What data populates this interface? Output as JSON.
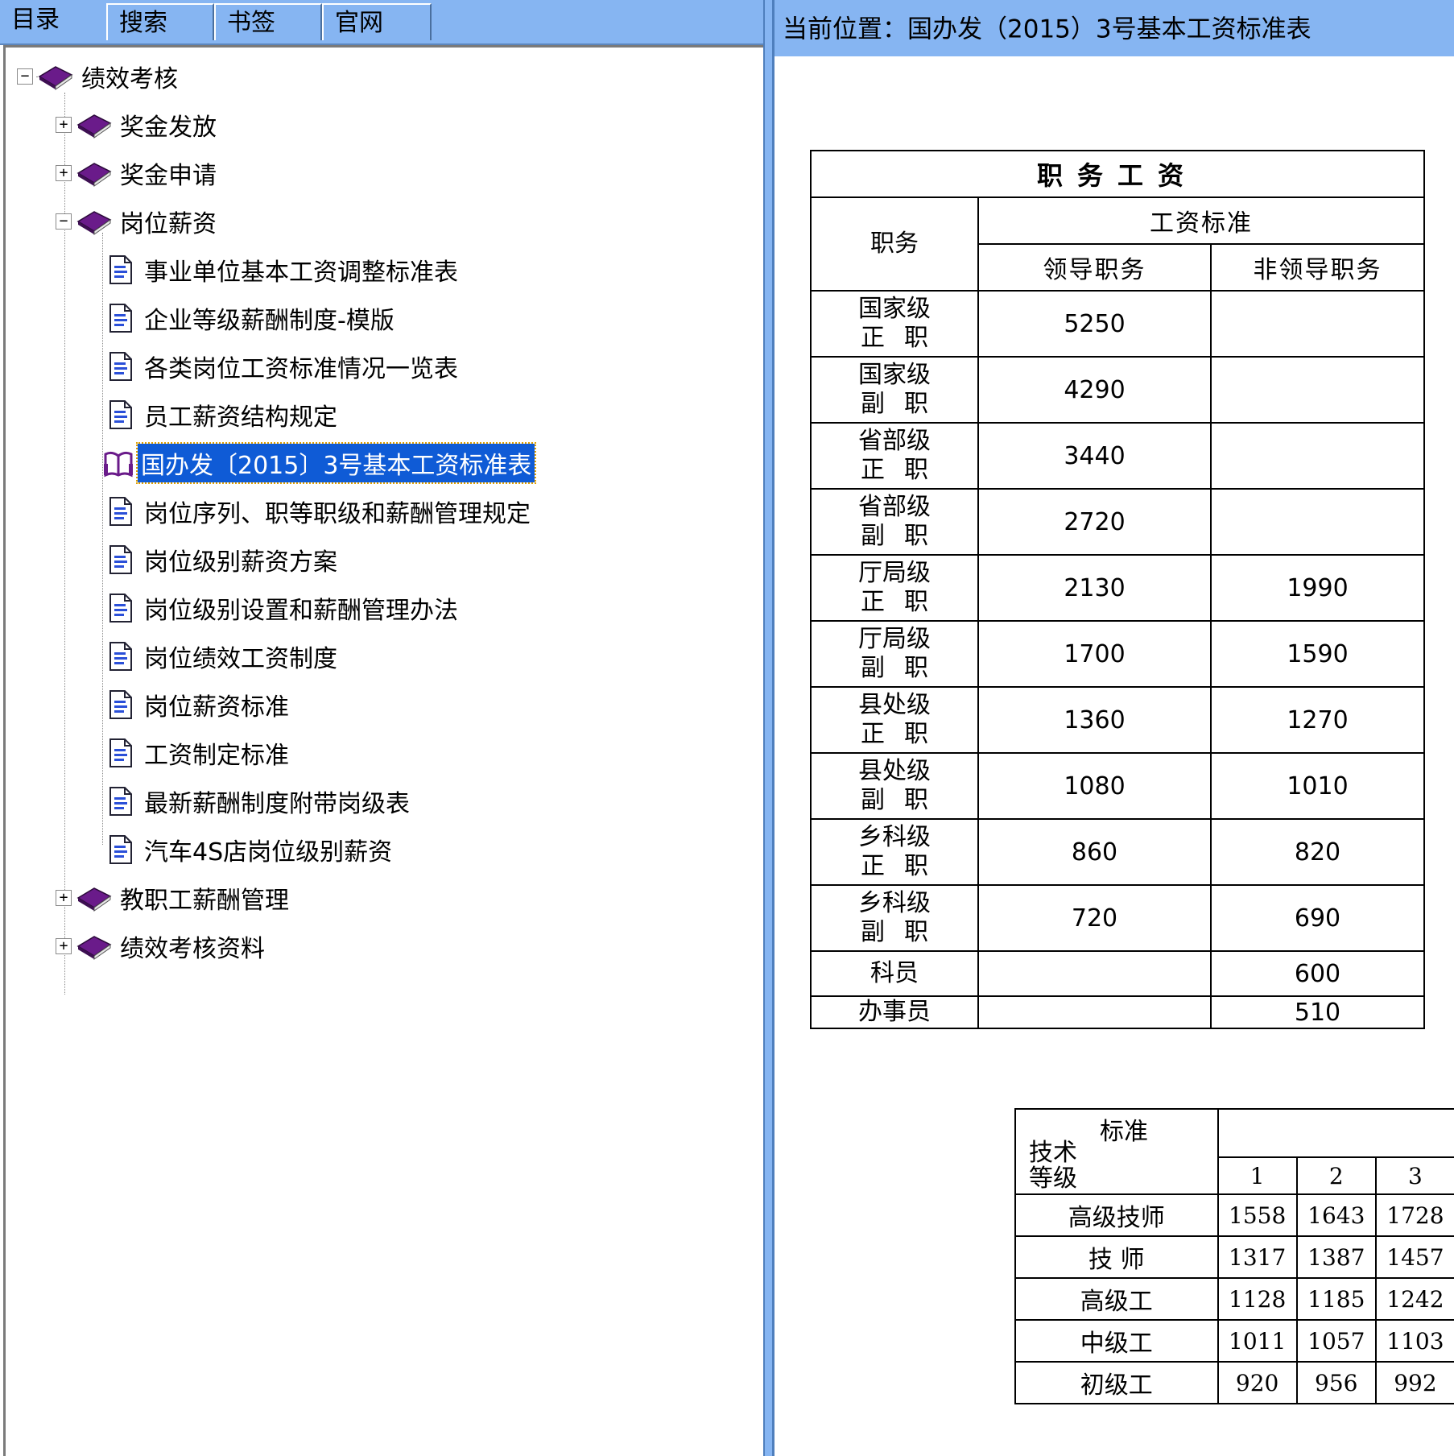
{
  "tabs": [
    {
      "label": "目录",
      "active": true
    },
    {
      "label": "搜索",
      "active": false
    },
    {
      "label": "书签",
      "active": false
    },
    {
      "label": "官网",
      "active": false
    }
  ],
  "tree": {
    "root": {
      "label": "绩效考核",
      "expander": "−"
    },
    "level1": [
      {
        "label": "奖金发放",
        "expander": "+"
      },
      {
        "label": "奖金申请",
        "expander": "+"
      },
      {
        "label": "岗位薪资",
        "expander": "−"
      },
      {
        "label": "教职工薪酬管理",
        "expander": "+"
      },
      {
        "label": "绩效考核资料",
        "expander": "+"
      }
    ],
    "docs": [
      {
        "label": "事业单位基本工资调整标准表"
      },
      {
        "label": "企业等级薪酬制度-模版"
      },
      {
        "label": "各类岗位工资标准情况一览表"
      },
      {
        "label": "员工薪资结构规定"
      },
      {
        "label": "国办发〔2015〕3号基本工资标准表",
        "selected": true
      },
      {
        "label": "岗位序列、职等职级和薪酬管理规定"
      },
      {
        "label": "岗位级别薪资方案"
      },
      {
        "label": "岗位级别设置和薪酬管理办法"
      },
      {
        "label": "岗位绩效工资制度"
      },
      {
        "label": "岗位薪资标准"
      },
      {
        "label": "工资制定标准"
      },
      {
        "label": "最新薪酬制度附带岗级表"
      },
      {
        "label": "汽车4S店岗位级别薪资"
      }
    ]
  },
  "location": {
    "prefix": "当前位置：",
    "title": "国办发（2015）3号基本工资标准表"
  },
  "salary_table": {
    "title": "职务工资",
    "col_position": "职务",
    "col_standard": "工资标准",
    "col_leader": "领导职务",
    "col_nonleader": "非领导职务",
    "rows": [
      {
        "level": "国家级",
        "rank": "正职",
        "leader": "5250",
        "nonleader": ""
      },
      {
        "level": "国家级",
        "rank": "副职",
        "leader": "4290",
        "nonleader": ""
      },
      {
        "level": "省部级",
        "rank": "正职",
        "leader": "3440",
        "nonleader": ""
      },
      {
        "level": "省部级",
        "rank": "副职",
        "leader": "2720",
        "nonleader": ""
      },
      {
        "level": "厅局级",
        "rank": "正职",
        "leader": "2130",
        "nonleader": "1990"
      },
      {
        "level": "厅局级",
        "rank": "副职",
        "leader": "1700",
        "nonleader": "1590"
      },
      {
        "level": "县处级",
        "rank": "正职",
        "leader": "1360",
        "nonleader": "1270"
      },
      {
        "level": "县处级",
        "rank": "副职",
        "leader": "1080",
        "nonleader": "1010"
      },
      {
        "level": "乡科级",
        "rank": "正职",
        "leader": "860",
        "nonleader": "820"
      },
      {
        "level": "乡科级",
        "rank": "副职",
        "leader": "720",
        "nonleader": "690"
      }
    ],
    "single_rows": [
      {
        "position": "科员",
        "leader": "",
        "nonleader": "600"
      },
      {
        "position": "办事员",
        "leader": "",
        "nonleader": "510"
      }
    ]
  },
  "grade_table": {
    "corner_standard": "标准",
    "corner_tech_1": "技术",
    "corner_tech_2": "等级",
    "columns": [
      "1",
      "2",
      "3"
    ],
    "rows": [
      {
        "grade": "高级技师",
        "values": [
          "1558",
          "1643",
          "1728"
        ]
      },
      {
        "grade": "技 师",
        "values": [
          "1317",
          "1387",
          "1457"
        ]
      },
      {
        "grade": "高级工",
        "values": [
          "1128",
          "1185",
          "1242"
        ]
      },
      {
        "grade": "中级工",
        "values": [
          "1011",
          "1057",
          "1103"
        ]
      },
      {
        "grade": "初级工",
        "values": [
          "920",
          "956",
          "992"
        ]
      }
    ]
  },
  "colors": {
    "chrome_blue": "#86b5f2",
    "selection_blue": "#0f5bd6",
    "book_purple": "#6a1b8a"
  }
}
